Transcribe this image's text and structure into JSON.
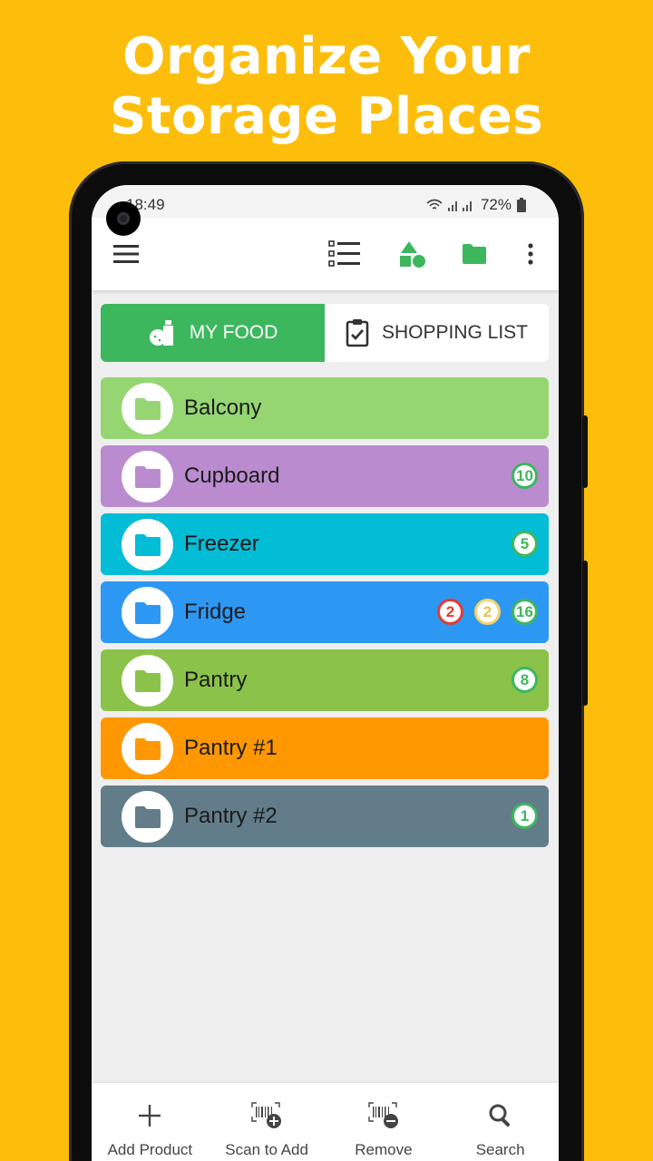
{
  "headline": {
    "line1": "Organize Your",
    "line2": "Storage Places"
  },
  "status": {
    "time": "18:49",
    "battery": "72%"
  },
  "appbar": {
    "menu_icon": "hamburger-icon",
    "list_icon": "list-view-icon",
    "categories_icon": "shapes-icon",
    "folder_icon": "folder-icon",
    "more_icon": "more-vert-icon"
  },
  "tabs": {
    "my_food": "MY FOOD",
    "shopping_list": "SHOPPING LIST"
  },
  "places": [
    {
      "name": "Balcony",
      "color": "#96D672",
      "folder_color": "#96D672",
      "badges": []
    },
    {
      "name": "Cupboard",
      "color": "#BA8CCF",
      "folder_color": "#BA8CCF",
      "badges": [
        {
          "value": "10",
          "kind": "green"
        }
      ]
    },
    {
      "name": "Freezer",
      "color": "#03BCD6",
      "folder_color": "#03BCD6",
      "badges": [
        {
          "value": "5",
          "kind": "green"
        }
      ]
    },
    {
      "name": "Fridge",
      "color": "#2D98F3",
      "folder_color": "#2D98F3",
      "badges": [
        {
          "value": "2",
          "kind": "red"
        },
        {
          "value": "2",
          "kind": "yellow"
        },
        {
          "value": "16",
          "kind": "green"
        }
      ]
    },
    {
      "name": "Pantry",
      "color": "#8BC24A",
      "folder_color": "#8BC24A",
      "badges": [
        {
          "value": "8",
          "kind": "green"
        }
      ]
    },
    {
      "name": "Pantry #1",
      "color": "#FF9800",
      "folder_color": "#FF9800",
      "badges": []
    },
    {
      "name": "Pantry #2",
      "color": "#627D89",
      "folder_color": "#627D89",
      "badges": [
        {
          "value": "1",
          "kind": "green"
        }
      ]
    }
  ],
  "bottom_nav": {
    "add_product": "Add Product",
    "scan_to_add": "Scan to Add",
    "remove": "Remove",
    "search": "Search"
  },
  "colors": {
    "background": "#FDBE0B",
    "accent": "#3DB75E"
  }
}
